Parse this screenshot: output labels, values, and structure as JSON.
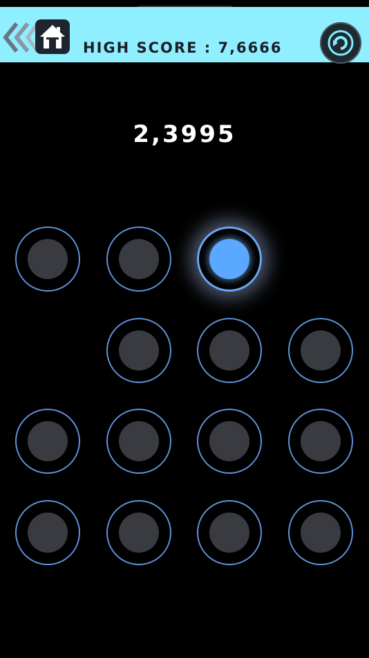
{
  "header": {
    "high_score_label": "HIGH SCORE",
    "separator": ":",
    "high_score_value": "7,6666",
    "back_icon": "double-chevron-left-icon",
    "home_icon": "home-icon",
    "refresh_icon": "refresh-icon"
  },
  "game": {
    "current_score": "2,3995",
    "grid_rows": [
      [
        true,
        true,
        true,
        false
      ],
      [
        false,
        true,
        true,
        true
      ],
      [
        true,
        true,
        true,
        true
      ],
      [
        true,
        true,
        true,
        true
      ]
    ],
    "active_dot": {
      "row": 0,
      "col": 2
    }
  },
  "colors": {
    "topbar": "#8fefff",
    "ring": "#5e93d8",
    "dot_core": "#393b40",
    "dot_active": "#5aa8ff",
    "background": "#000000"
  }
}
